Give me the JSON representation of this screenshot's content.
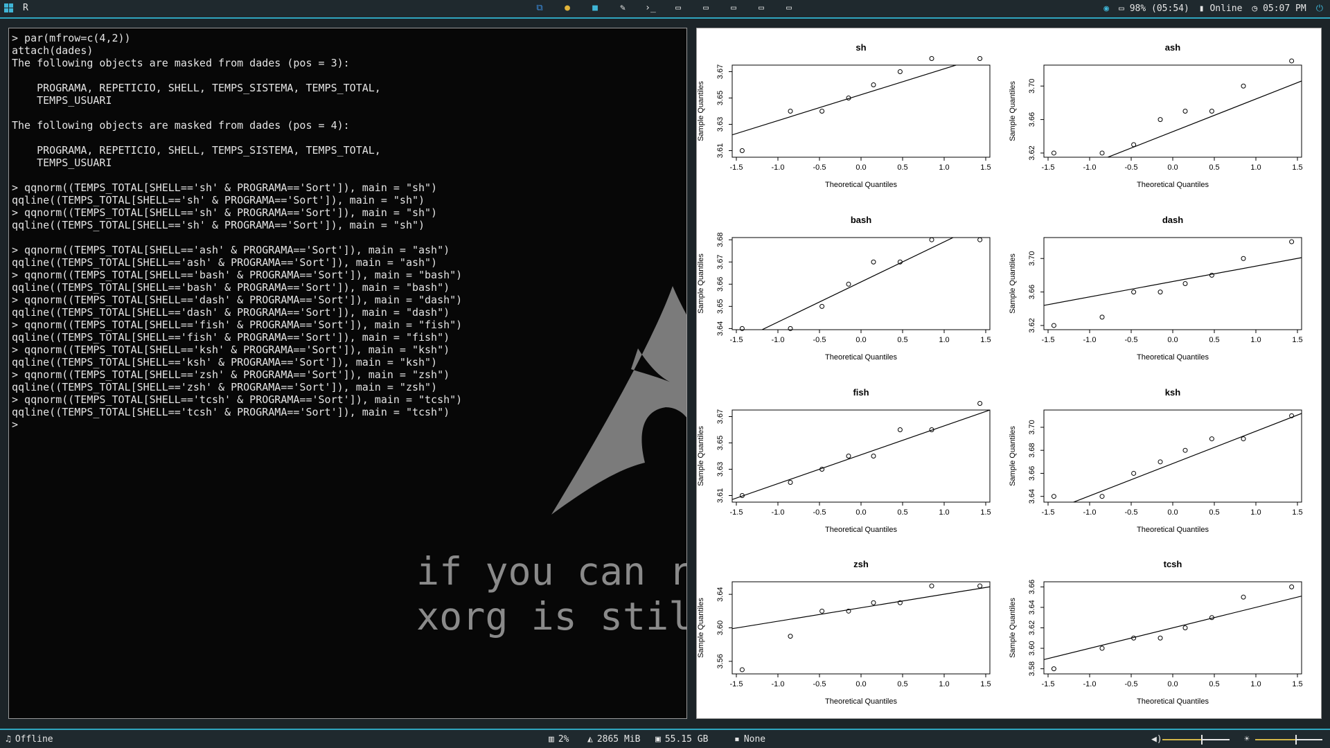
{
  "topbar": {
    "title": "R",
    "battery": "98% (05:54)",
    "network": "Online",
    "clock": "05:07 PM",
    "center_icons": [
      "vscode-icon",
      "chrome-icon",
      "folder-icon",
      "editor-icon",
      "terminal-icon",
      "monitor-icon",
      "monitor-icon",
      "monitor-icon",
      "monitor-icon",
      "monitor-icon"
    ]
  },
  "terminal": {
    "lines": [
      "> par(mfrow=c(4,2))",
      "attach(dades)",
      "The following objects are masked from dades (pos = 3):",
      "",
      "    PROGRAMA, REPETICIO, SHELL, TEMPS_SISTEMA, TEMPS_TOTAL,",
      "    TEMPS_USUARI",
      "",
      "The following objects are masked from dades (pos = 4):",
      "",
      "    PROGRAMA, REPETICIO, SHELL, TEMPS_SISTEMA, TEMPS_TOTAL,",
      "    TEMPS_USUARI",
      "",
      "> qqnorm((TEMPS_TOTAL[SHELL=='sh' & PROGRAMA=='Sort']), main = \"sh\")",
      "qqline((TEMPS_TOTAL[SHELL=='sh' & PROGRAMA=='Sort']), main = \"sh\")",
      "> qqnorm((TEMPS_TOTAL[SHELL=='sh' & PROGRAMA=='Sort']), main = \"sh\")",
      "qqline((TEMPS_TOTAL[SHELL=='sh' & PROGRAMA=='Sort']), main = \"sh\")",
      "",
      "> qqnorm((TEMPS_TOTAL[SHELL=='ash' & PROGRAMA=='Sort']), main = \"ash\")",
      "qqline((TEMPS_TOTAL[SHELL=='ash' & PROGRAMA=='Sort']), main = \"ash\")",
      "> qqnorm((TEMPS_TOTAL[SHELL=='bash' & PROGRAMA=='Sort']), main = \"bash\")",
      "qqline((TEMPS_TOTAL[SHELL=='bash' & PROGRAMA=='Sort']), main = \"bash\")",
      "> qqnorm((TEMPS_TOTAL[SHELL=='dash' & PROGRAMA=='Sort']), main = \"dash\")",
      "qqline((TEMPS_TOTAL[SHELL=='dash' & PROGRAMA=='Sort']), main = \"dash\")",
      "> qqnorm((TEMPS_TOTAL[SHELL=='fish' & PROGRAMA=='Sort']), main = \"fish\")",
      "qqline((TEMPS_TOTAL[SHELL=='fish' & PROGRAMA=='Sort']), main = \"fish\")",
      "> qqnorm((TEMPS_TOTAL[SHELL=='ksh' & PROGRAMA=='Sort']), main = \"ksh\")",
      "qqline((TEMPS_TOTAL[SHELL=='ksh' & PROGRAMA=='Sort']), main = \"ksh\")",
      "> qqnorm((TEMPS_TOTAL[SHELL=='zsh' & PROGRAMA=='Sort']), main = \"zsh\")",
      "qqline((TEMPS_TOTAL[SHELL=='zsh' & PROGRAMA=='Sort']), main = \"zsh\")",
      "> qqnorm((TEMPS_TOTAL[SHELL=='tcsh' & PROGRAMA=='Sort']), main = \"tcsh\")",
      "qqline((TEMPS_TOTAL[SHELL=='tcsh' & PROGRAMA=='Sort']), main = \"tcsh\")",
      ">"
    ]
  },
  "wallpaper": {
    "line1": "if you can r",
    "line2": "xorg is stil"
  },
  "chart_data": [
    {
      "type": "scatter",
      "title": "sh",
      "xlabel": "Theoretical Quantiles",
      "ylabel": "Sample Quantiles",
      "xlim": [
        -1.55,
        1.55
      ],
      "ylim": [
        3.605,
        3.675
      ],
      "xticks": [
        "-1.5",
        "-1.0",
        "-0.5",
        "0.0",
        "0.5",
        "1.0",
        "1.5"
      ],
      "yticks": [
        "3.61",
        "3.63",
        "3.65",
        "3.67"
      ],
      "x": [
        -1.43,
        -0.85,
        -0.47,
        -0.15,
        0.15,
        0.47,
        0.85,
        1.43
      ],
      "y": [
        3.61,
        3.64,
        3.64,
        3.65,
        3.66,
        3.67,
        3.68,
        3.68
      ],
      "line": [
        [
          -1.55,
          3.622
        ],
        [
          1.55,
          3.683
        ]
      ]
    },
    {
      "type": "scatter",
      "title": "ash",
      "xlabel": "Theoretical Quantiles",
      "ylabel": "Sample Quantiles",
      "xlim": [
        -1.55,
        1.55
      ],
      "ylim": [
        3.615,
        3.725
      ],
      "xticks": [
        "-1.5",
        "-1.0",
        "-0.5",
        "0.0",
        "0.5",
        "1.0",
        "1.5"
      ],
      "yticks": [
        "3.62",
        "3.66",
        "3.70"
      ],
      "x": [
        -1.43,
        -0.85,
        -0.47,
        -0.15,
        0.15,
        0.47,
        0.85,
        1.43
      ],
      "y": [
        3.62,
        3.62,
        3.63,
        3.66,
        3.67,
        3.67,
        3.7,
        3.73
      ],
      "line": [
        [
          -1.55,
          3.585
        ],
        [
          1.55,
          3.706
        ]
      ]
    },
    {
      "type": "scatter",
      "title": "bash",
      "xlabel": "Theoretical Quantiles",
      "ylabel": "Sample Quantiles",
      "xlim": [
        -1.55,
        1.55
      ],
      "ylim": [
        3.6395,
        3.681
      ],
      "xticks": [
        "-1.5",
        "-1.0",
        "-0.5",
        "0.0",
        "0.5",
        "1.0",
        "1.5"
      ],
      "yticks": [
        "3.64",
        "3.65",
        "3.66",
        "3.67",
        "3.68"
      ],
      "x": [
        -1.43,
        -0.85,
        -0.47,
        -0.15,
        0.15,
        0.47,
        0.85,
        1.43
      ],
      "y": [
        3.64,
        3.64,
        3.65,
        3.66,
        3.67,
        3.67,
        3.68,
        3.68
      ],
      "line": [
        [
          -1.55,
          3.633
        ],
        [
          1.55,
          3.689
        ]
      ]
    },
    {
      "type": "scatter",
      "title": "dash",
      "xlabel": "Theoretical Quantiles",
      "ylabel": "Sample Quantiles",
      "xlim": [
        -1.55,
        1.55
      ],
      "ylim": [
        3.615,
        3.725
      ],
      "xticks": [
        "-1.5",
        "-1.0",
        "-0.5",
        "0.0",
        "0.5",
        "1.0",
        "1.5"
      ],
      "yticks": [
        "3.62",
        "3.66",
        "3.70"
      ],
      "x": [
        -1.43,
        -0.85,
        -0.47,
        -0.15,
        0.15,
        0.47,
        0.85,
        1.43
      ],
      "y": [
        3.62,
        3.63,
        3.66,
        3.66,
        3.67,
        3.68,
        3.7,
        3.72
      ],
      "line": [
        [
          -1.55,
          3.644
        ],
        [
          1.55,
          3.701
        ]
      ]
    },
    {
      "type": "scatter",
      "title": "fish",
      "xlabel": "Theoretical Quantiles",
      "ylabel": "Sample Quantiles",
      "xlim": [
        -1.55,
        1.55
      ],
      "ylim": [
        3.605,
        3.675
      ],
      "xticks": [
        "-1.5",
        "-1.0",
        "-0.5",
        "0.0",
        "0.5",
        "1.0",
        "1.5"
      ],
      "yticks": [
        "3.61",
        "3.63",
        "3.65",
        "3.67"
      ],
      "x": [
        -1.43,
        -0.85,
        -0.47,
        -0.15,
        0.15,
        0.47,
        0.85,
        1.43
      ],
      "y": [
        3.61,
        3.62,
        3.63,
        3.64,
        3.64,
        3.66,
        3.66,
        3.68
      ],
      "line": [
        [
          -1.55,
          3.607
        ],
        [
          1.55,
          3.675
        ]
      ]
    },
    {
      "type": "scatter",
      "title": "ksh",
      "xlabel": "Theoretical Quantiles",
      "ylabel": "Sample Quantiles",
      "xlim": [
        -1.55,
        1.55
      ],
      "ylim": [
        3.635,
        3.715
      ],
      "xticks": [
        "-1.5",
        "-1.0",
        "-0.5",
        "0.0",
        "0.5",
        "1.0",
        "1.5"
      ],
      "yticks": [
        "3.64",
        "3.66",
        "3.68",
        "3.70"
      ],
      "x": [
        -1.43,
        -0.85,
        -0.47,
        -0.15,
        0.15,
        0.47,
        0.85,
        1.43
      ],
      "y": [
        3.64,
        3.64,
        3.66,
        3.67,
        3.68,
        3.69,
        3.69,
        3.71
      ],
      "line": [
        [
          -1.55,
          3.625
        ],
        [
          1.55,
          3.712
        ]
      ]
    },
    {
      "type": "scatter",
      "title": "zsh",
      "xlabel": "Theoretical Quantiles",
      "ylabel": "Sample Quantiles",
      "xlim": [
        -1.55,
        1.55
      ],
      "ylim": [
        3.545,
        3.655
      ],
      "xticks": [
        "-1.5",
        "-1.0",
        "-0.5",
        "0.0",
        "0.5",
        "1.0",
        "1.5"
      ],
      "yticks": [
        "3.56",
        "3.60",
        "3.64"
      ],
      "x": [
        -1.43,
        -0.85,
        -0.47,
        -0.15,
        0.15,
        0.47,
        0.85,
        1.43
      ],
      "y": [
        3.55,
        3.59,
        3.62,
        3.62,
        3.63,
        3.63,
        3.65,
        3.65
      ],
      "line": [
        [
          -1.55,
          3.599
        ],
        [
          1.55,
          3.649
        ]
      ]
    },
    {
      "type": "scatter",
      "title": "tcsh",
      "xlabel": "Theoretical Quantiles",
      "ylabel": "Sample Quantiles",
      "xlim": [
        -1.55,
        1.55
      ],
      "ylim": [
        3.575,
        3.665
      ],
      "xticks": [
        "-1.5",
        "-1.0",
        "-0.5",
        "0.0",
        "0.5",
        "1.0",
        "1.5"
      ],
      "yticks": [
        "3.58",
        "3.60",
        "3.62",
        "3.64",
        "3.66"
      ],
      "x": [
        -1.43,
        -0.85,
        -0.47,
        -0.15,
        0.15,
        0.47,
        0.85,
        1.43
      ],
      "y": [
        3.58,
        3.6,
        3.61,
        3.61,
        3.62,
        3.63,
        3.65,
        3.66
      ],
      "line": [
        [
          -1.55,
          3.589
        ],
        [
          1.55,
          3.651
        ]
      ]
    }
  ],
  "bottombar": {
    "music": "Offline",
    "cpu": "2%",
    "memory": "2865 MiB",
    "disk": "55.15 GB",
    "other": "None",
    "volume_level": 0.58,
    "brightness_level": 0.6
  },
  "colors": {
    "accent": "#2fa6c0",
    "terminal_bg": "#070707",
    "bar_bg": "#1f292e",
    "slider_gold": "#d4b84a"
  }
}
